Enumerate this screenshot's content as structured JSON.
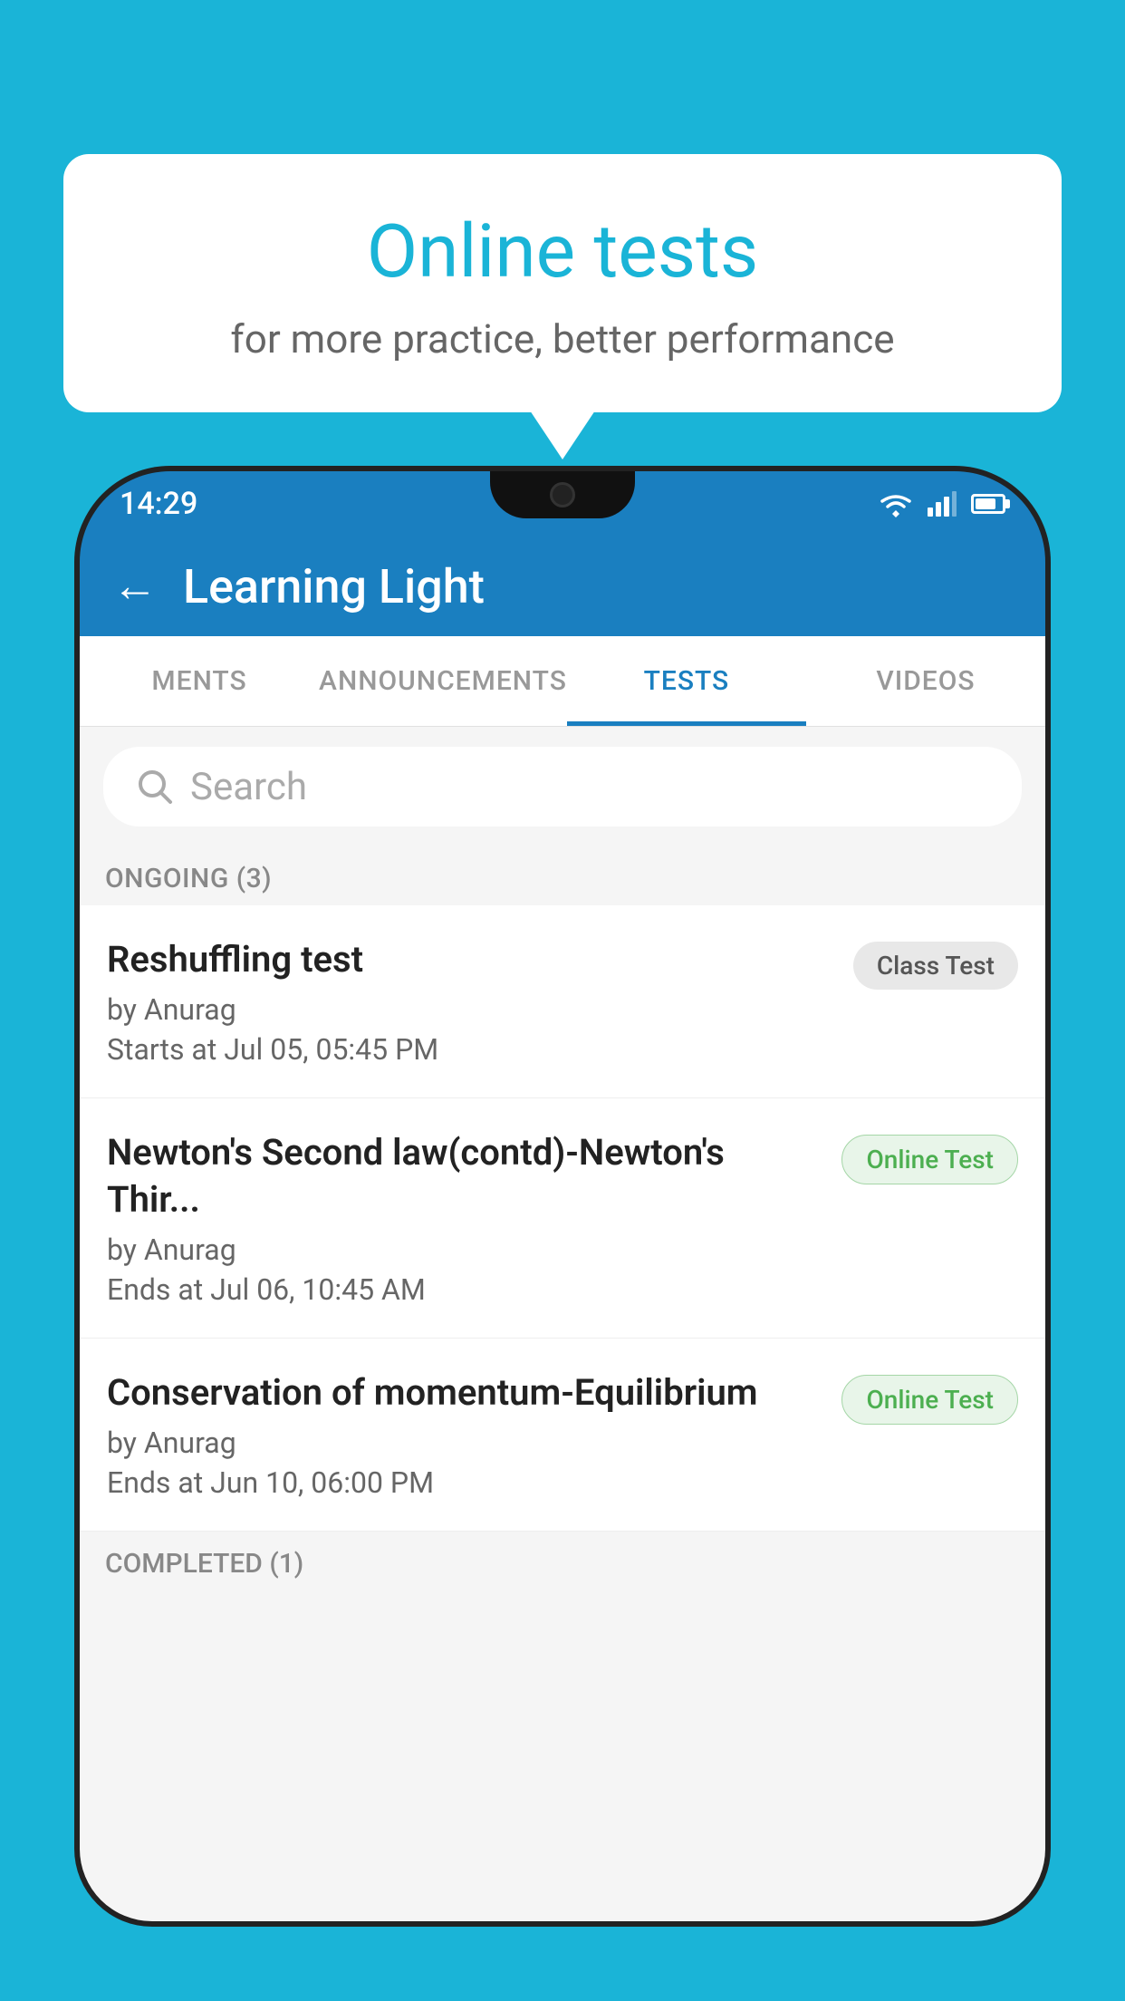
{
  "background": {
    "color": "#1ab4d7"
  },
  "speech_bubble": {
    "title": "Online tests",
    "subtitle": "for more practice, better performance"
  },
  "phone": {
    "status_bar": {
      "time": "14:29"
    },
    "app_bar": {
      "back_label": "←",
      "title": "Learning Light"
    },
    "tabs": [
      {
        "label": "MENTS",
        "active": false
      },
      {
        "label": "ANNOUNCEMENTS",
        "active": false
      },
      {
        "label": "TESTS",
        "active": true
      },
      {
        "label": "VIDEOS",
        "active": false
      }
    ],
    "search": {
      "placeholder": "Search"
    },
    "ongoing_section": {
      "label": "ONGOING (3)"
    },
    "tests": [
      {
        "name": "Reshuffling test",
        "author": "by Anurag",
        "time_label": "Starts at",
        "time": "Jul 05, 05:45 PM",
        "badge": "Class Test",
        "badge_type": "class"
      },
      {
        "name": "Newton's Second law(contd)-Newton's Thir...",
        "author": "by Anurag",
        "time_label": "Ends at",
        "time": "Jul 06, 10:45 AM",
        "badge": "Online Test",
        "badge_type": "online"
      },
      {
        "name": "Conservation of momentum-Equilibrium",
        "author": "by Anurag",
        "time_label": "Ends at",
        "time": "Jun 10, 06:00 PM",
        "badge": "Online Test",
        "badge_type": "online"
      }
    ],
    "completed_section": {
      "label": "COMPLETED (1)"
    }
  }
}
